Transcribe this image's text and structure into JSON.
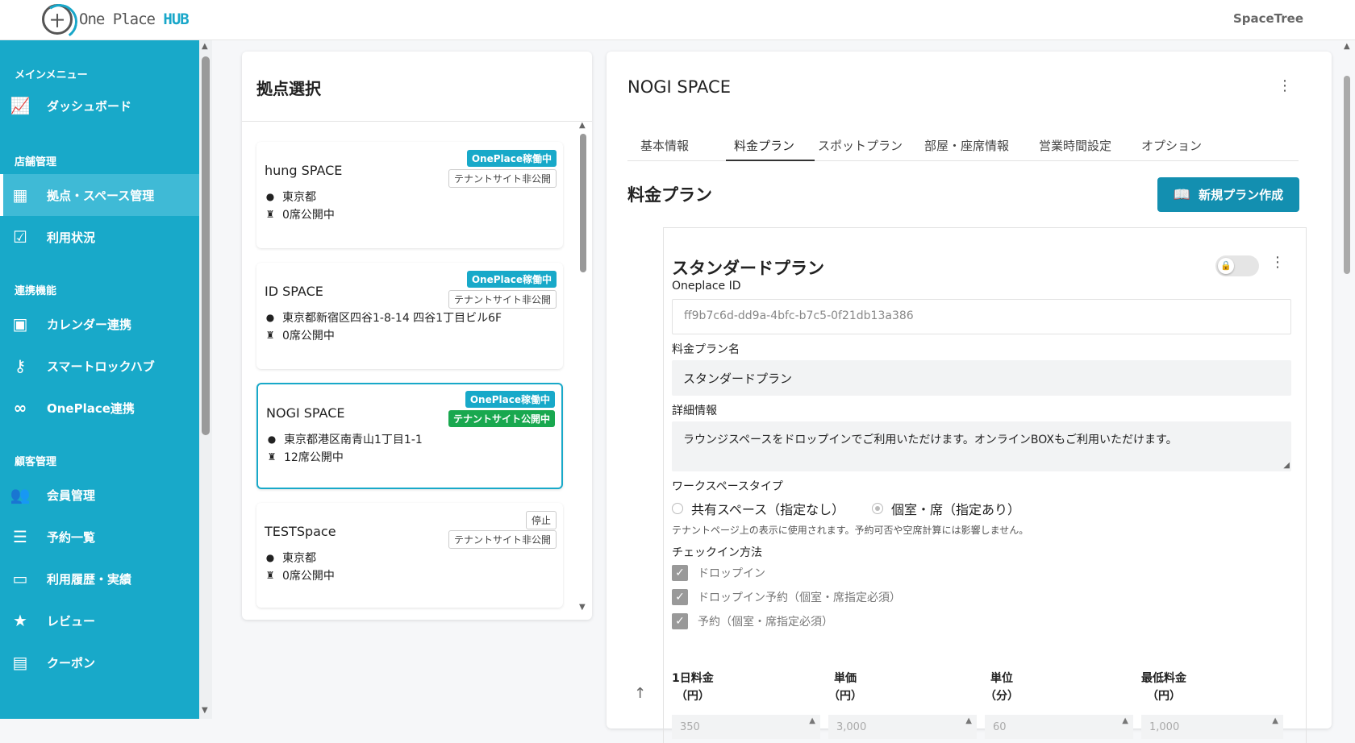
{
  "app": {
    "logo_text": "One Place ",
    "logo_accent": "HUB",
    "logo_glyph": "十",
    "account": "SpaceTree"
  },
  "sidebar": {
    "sections": [
      "メインメニュー",
      "店舗管理",
      "連携機能",
      "顧客管理"
    ],
    "items": [
      {
        "label": "ダッシュボード",
        "icon": "chart-line-icon"
      },
      {
        "label": "拠点・スペース管理",
        "icon": "building-icon",
        "active": true
      },
      {
        "label": "利用状況",
        "icon": "calendar-check-icon"
      },
      {
        "label": "カレンダー連携",
        "icon": "calendar-plus-icon"
      },
      {
        "label": "スマートロックハブ",
        "icon": "key-icon"
      },
      {
        "label": "OnePlace連携",
        "icon": "link-icon"
      },
      {
        "label": "会員管理",
        "icon": "users-icon"
      },
      {
        "label": "予約一覧",
        "icon": "list-icon"
      },
      {
        "label": "利用履歴・実績",
        "icon": "credit-card-icon"
      },
      {
        "label": "レビュー",
        "icon": "star-icon"
      },
      {
        "label": "クーポン",
        "icon": "ticket-icon"
      }
    ]
  },
  "locations": {
    "title": "拠点選択",
    "items": [
      {
        "name": "hung SPACE",
        "badge1": "OnePlace稼働中",
        "badge2": "テナントサイト非公開",
        "address": "東京都",
        "seats": "0席公開中"
      },
      {
        "name": "ID SPACE",
        "badge1": "OnePlace稼働中",
        "badge2": "テナントサイト非公開",
        "address": "東京都新宿区四谷1-8-14 四谷1丁目ビル6F",
        "seats": "0席公開中"
      },
      {
        "name": "NOGI SPACE",
        "badge1": "OnePlace稼働中",
        "badge2": "テナントサイト公開中",
        "address": "東京都港区南青山1丁目1-1",
        "seats": "12席公開中"
      },
      {
        "name": "TESTSpace",
        "badge1": "停止",
        "badge2": "テナントサイト非公開",
        "address": "東京都",
        "seats": "0席公開中"
      }
    ]
  },
  "detail": {
    "title": "NOGI SPACE",
    "tabs": [
      "基本情報",
      "料金プラン",
      "スポットプラン",
      "部屋・座席情報",
      "営業時間設定",
      "オプション"
    ],
    "active_tab": "料金プラン",
    "section_title": "料金プラン",
    "new_button": "新規プラン作成",
    "plan": {
      "title": "スタンダードプラン",
      "id_label": "Oneplace ID",
      "id_value": "ff9b7c6d-dd9a-4bfc-b7c5-0f21db13a386",
      "name_label": "料金プラン名",
      "name_value": "スタンダードプラン",
      "detail_label": "詳細情報",
      "detail_value": "ラウンジスペースをドロップインでご利用いただけます。オンラインBOXもご利用いただけます。",
      "ws_label": "ワークスペースタイプ",
      "ws_opt1": "共有スペース（指定なし）",
      "ws_opt2": "個室・席（指定あり）",
      "ws_note": "テナントページ上の表示に使用されます。予約可否や空席計算には影響しません。",
      "checkin_label": "チェックイン方法",
      "checkins": [
        "ドロップイン",
        "ドロップイン予約（個室・席指定必須）",
        "予約（個室・席指定必須）"
      ],
      "cols": [
        {
          "l1": "1日料金",
          "l2": "（円）",
          "value": "350"
        },
        {
          "l1": "単価",
          "l2": "（円）",
          "value": "3,000"
        },
        {
          "l1": "単位",
          "l2": "（分）",
          "value": "60"
        },
        {
          "l1": "最低料金",
          "l2": "（円）",
          "value": "1,000"
        }
      ]
    }
  },
  "colors": {
    "accent": "#18a9c9",
    "green": "#19a84f",
    "button": "#138fb0"
  }
}
